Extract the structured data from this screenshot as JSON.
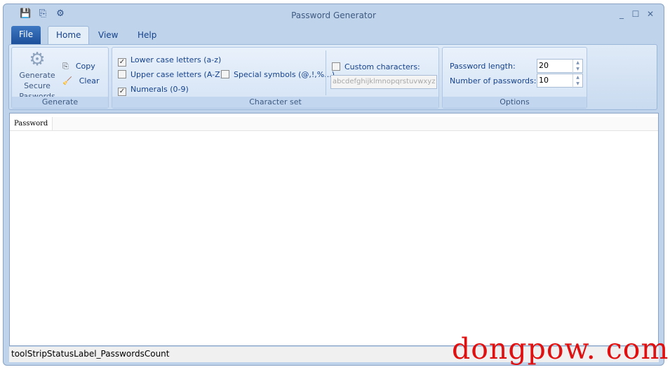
{
  "window": {
    "title": "Password Generator",
    "quick_access": [
      "save-icon",
      "copy-icon",
      "settings-icon"
    ],
    "controls": [
      "_",
      "☐",
      "✕"
    ]
  },
  "tabs": [
    {
      "label": "File"
    },
    {
      "label": "Home"
    },
    {
      "label": "View"
    },
    {
      "label": "Help"
    }
  ],
  "ribbon": {
    "generate": {
      "label": "Generate",
      "generate_button": "Generate Secure Paswords",
      "copy": "Copy",
      "clear": "Clear"
    },
    "charset": {
      "label": "Character set",
      "lower": {
        "label": "Lower case letters (a-z)",
        "checked": true
      },
      "upper": {
        "label": "Upper case letters (A-Z)",
        "checked": false
      },
      "numerals": {
        "label": "Numerals (0-9)",
        "checked": true
      },
      "special": {
        "label": "Special symbols (@,!,%...)",
        "checked": false
      },
      "custom": {
        "label": "Custom characters:",
        "checked": false
      },
      "custom_value": "abcdefghijklmnopqrstuvwxyz"
    },
    "options": {
      "label": "Options",
      "length_label": "Password length:",
      "length_value": "20",
      "count_label": "Number of passwords:",
      "count_value": "10"
    }
  },
  "list": {
    "columns": [
      "Password"
    ],
    "rows": []
  },
  "status": {
    "text": "toolStripStatusLabel_PasswordsCount"
  },
  "watermark": "dongpow. com"
}
